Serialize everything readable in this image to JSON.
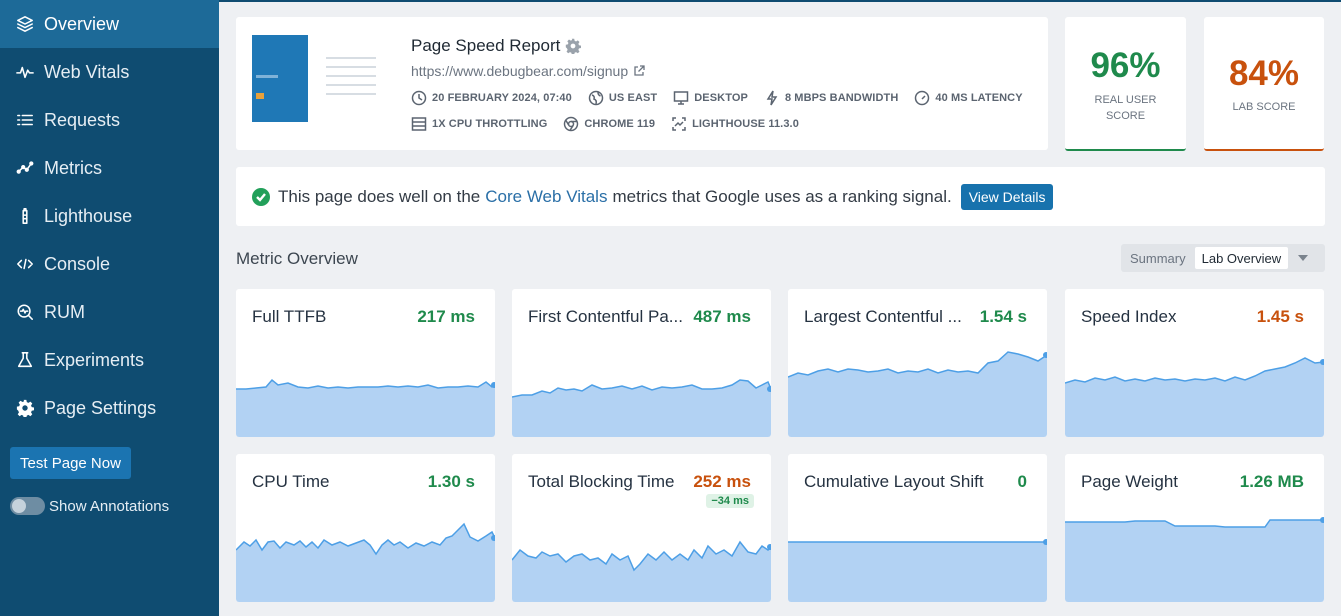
{
  "sidebar": {
    "items": [
      {
        "label": "Overview",
        "icon": "layers-icon",
        "active": true
      },
      {
        "label": "Web Vitals",
        "icon": "pulse-icon"
      },
      {
        "label": "Requests",
        "icon": "list-icon"
      },
      {
        "label": "Metrics",
        "icon": "scatter-icon"
      },
      {
        "label": "Lighthouse",
        "icon": "lighthouse-icon"
      },
      {
        "label": "Console",
        "icon": "code-icon"
      },
      {
        "label": "RUM",
        "icon": "search-pulse-icon"
      },
      {
        "label": "Experiments",
        "icon": "flask-icon"
      },
      {
        "label": "Page Settings",
        "icon": "gear-icon"
      }
    ],
    "test_button": "Test Page Now",
    "annotations_label": "Show Annotations"
  },
  "report": {
    "title": "Page Speed Report",
    "url": "https://www.debugbear.com/signup",
    "date": "20 FEBRUARY 2024, 07:40",
    "region": "US EAST",
    "device": "DESKTOP",
    "bandwidth": "8 MBPS BANDWIDTH",
    "latency": "40 MS LATENCY",
    "cpu": "1X CPU THROTTLING",
    "browser": "CHROME 119",
    "lighthouse": "LIGHTHOUSE 11.3.0"
  },
  "scores": {
    "real_user": {
      "value": "96%",
      "label": "REAL USER SCORE",
      "color": "#1f8a4c"
    },
    "lab": {
      "value": "84%",
      "label": "LAB SCORE",
      "color": "#c8510d"
    }
  },
  "cwv": {
    "prefix": "This page does well on the",
    "link": "Core Web Vitals",
    "suffix": "metrics that Google uses as a ranking signal.",
    "button": "View Details"
  },
  "overview": {
    "title": "Metric Overview",
    "switch_label": "Summary",
    "switch_selected": "Lab Overview"
  },
  "metrics": [
    {
      "name": "Full TTFB",
      "value": "217 ms",
      "status": "green"
    },
    {
      "name": "First Contentful Pa...",
      "value": "487 ms",
      "status": "green"
    },
    {
      "name": "Largest Contentful ...",
      "value": "1.54 s",
      "status": "green"
    },
    {
      "name": "Speed Index",
      "value": "1.45 s",
      "status": "orange"
    },
    {
      "name": "CPU Time",
      "value": "1.30 s",
      "status": "green"
    },
    {
      "name": "Total Blocking Time",
      "value": "252 ms",
      "status": "orange",
      "delta": "−34 ms"
    },
    {
      "name": "Cumulative Layout Shift",
      "value": "0",
      "status": "green"
    },
    {
      "name": "Page Weight",
      "value": "1.26 MB",
      "status": "green"
    }
  ],
  "colors": {
    "sidebar": "#0f4c71",
    "sidebar_active": "#1d6a98",
    "spark_fill": "#b2d2f3",
    "spark_line": "#4d9fe6"
  }
}
